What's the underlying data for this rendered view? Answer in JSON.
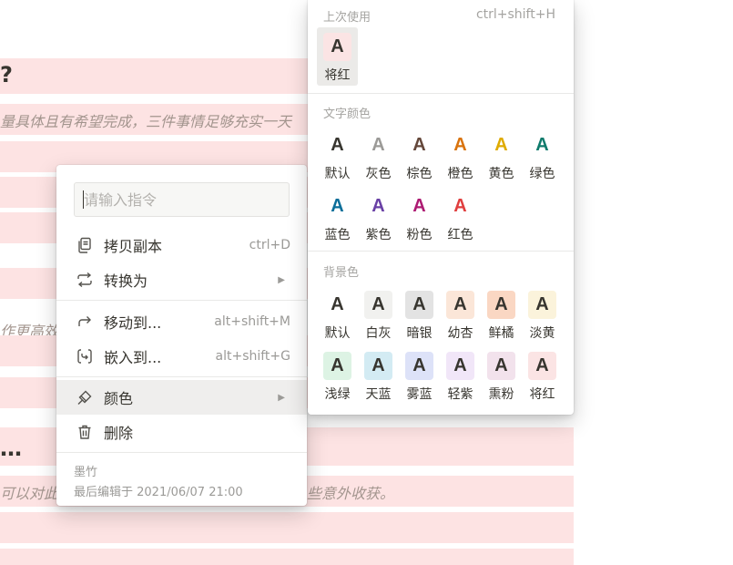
{
  "doc": {
    "heading1": "?",
    "italic1": "量具体且有希望完成，三件事情足够充实一天",
    "partial1": "作更高效",
    "heading2": "…",
    "italic2": "可以对此",
    "italic2_end": "些意外收获。"
  },
  "command_menu": {
    "placeholder": "请输入指令",
    "items": [
      {
        "label": "拷贝副本",
        "shortcut": "ctrl+D",
        "icon": "copy-icon"
      },
      {
        "label": "转换为",
        "submenu": "▶",
        "icon": "convert-icon"
      },
      {
        "label": "移动到...",
        "shortcut": "alt+shift+M",
        "icon": "move-arrow-icon"
      },
      {
        "label": "嵌入到...",
        "shortcut": "alt+shift+G",
        "icon": "embed-icon"
      },
      {
        "label": "颜色",
        "submenu": "▶",
        "icon": "paintbrush-icon"
      },
      {
        "label": "删除",
        "icon": "trash-icon"
      }
    ],
    "user": "墨竹",
    "last_edited": "最后编辑于 2021/06/07 21:00"
  },
  "color_panel": {
    "recent": {
      "label": "上次使用",
      "shortcut": "ctrl+shift+H",
      "items": [
        {
          "name": "将红",
          "fg": "#37352f",
          "bg": "#fbe4e4"
        }
      ]
    },
    "text_colors": {
      "label": "文字颜色",
      "items": [
        {
          "name": "默认",
          "fg": "#37352f"
        },
        {
          "name": "灰色",
          "fg": "#9b9a97"
        },
        {
          "name": "棕色",
          "fg": "#64473a"
        },
        {
          "name": "橙色",
          "fg": "#d9730d"
        },
        {
          "name": "黄色",
          "fg": "#dfab01"
        },
        {
          "name": "绿色",
          "fg": "#0f7b6c"
        },
        {
          "name": "蓝色",
          "fg": "#0b6e99"
        },
        {
          "name": "紫色",
          "fg": "#6940a5"
        },
        {
          "name": "粉色",
          "fg": "#ad1a72"
        },
        {
          "name": "红色",
          "fg": "#e03e3e"
        }
      ]
    },
    "bg_colors": {
      "label": "背景色",
      "items": [
        {
          "name": "默认",
          "fg": "#37352f",
          "bg": "#ffffff"
        },
        {
          "name": "白灰",
          "fg": "#37352f",
          "bg": "#f1f1ef"
        },
        {
          "name": "暗银",
          "fg": "#37352f",
          "bg": "#e3e3e3"
        },
        {
          "name": "幼杏",
          "fg": "#37352f",
          "bg": "#fbe6d8"
        },
        {
          "name": "鲜橘",
          "fg": "#37352f",
          "bg": "#fad7c3"
        },
        {
          "name": "淡黄",
          "fg": "#37352f",
          "bg": "#fbf3db"
        },
        {
          "name": "浅绿",
          "fg": "#37352f",
          "bg": "#ddf3e4"
        },
        {
          "name": "天蓝",
          "fg": "#37352f",
          "bg": "#d3ebf3"
        },
        {
          "name": "雾蓝",
          "fg": "#37352f",
          "bg": "#dde2f8"
        },
        {
          "name": "轻紫",
          "fg": "#37352f",
          "bg": "#f1e6f8"
        },
        {
          "name": "熏粉",
          "fg": "#37352f",
          "bg": "#f2e2ec"
        },
        {
          "name": "将红",
          "fg": "#37352f",
          "bg": "#fbe4e4"
        }
      ]
    }
  }
}
